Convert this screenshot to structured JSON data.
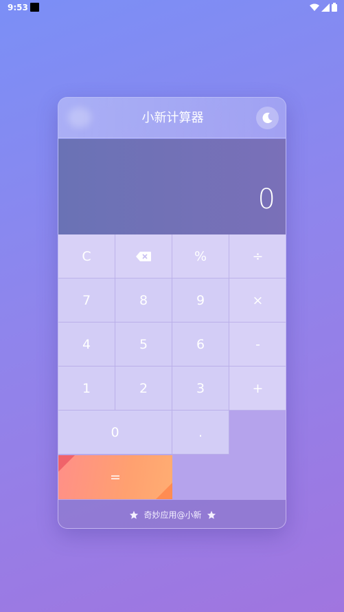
{
  "status_bar": {
    "time": "9:53"
  },
  "app": {
    "title": "小新计算器",
    "theme_icon": "moon-icon"
  },
  "display": {
    "value": "0"
  },
  "keys": {
    "clear": "C",
    "backspace_icon": "backspace-icon",
    "percent": "%",
    "divide": "÷",
    "seven": "7",
    "eight": "8",
    "nine": "9",
    "multiply": "×",
    "four": "4",
    "five": "5",
    "six": "6",
    "minus": "-",
    "one": "1",
    "two": "2",
    "three": "3",
    "plus": "+",
    "zero": "0",
    "dot": ".",
    "equals": "="
  },
  "footer": {
    "text": "奇妙应用@小新",
    "icon": "star-icon"
  },
  "colors": {
    "display_bg": "#6a72b5",
    "key_bg": "#d3cdf6",
    "equals_start": "#ff8f88",
    "equals_end": "#ffad72"
  }
}
